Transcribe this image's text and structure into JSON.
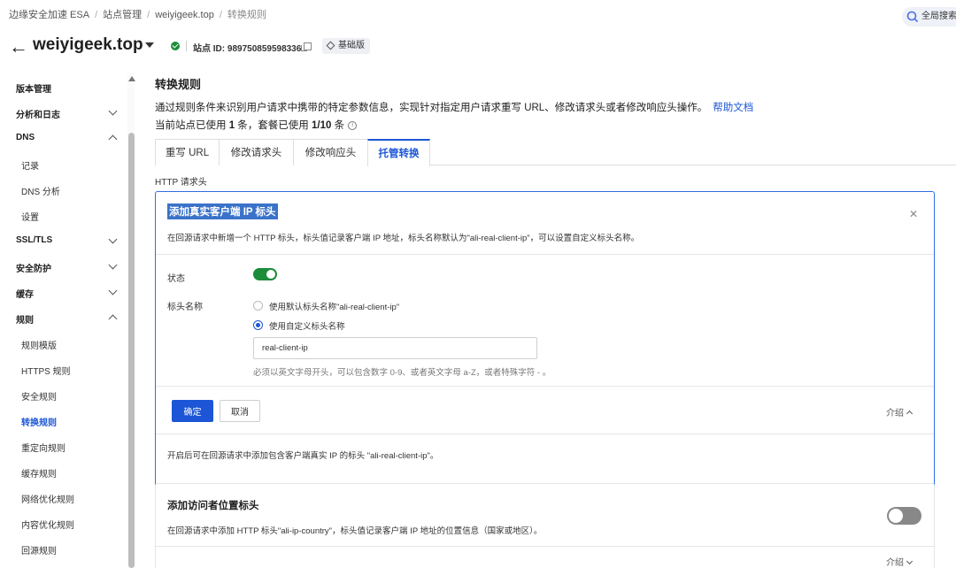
{
  "breadcrumb": {
    "items": [
      "边缘安全加速 ESA",
      "站点管理",
      "weiyigeek.top",
      "转换规则"
    ]
  },
  "global_search": {
    "label": "全局搜索"
  },
  "site": {
    "name": "weiyigeek.top",
    "id_text": "站点 ID: 989750859598336",
    "plan": "基础版"
  },
  "sidebar": {
    "items": [
      {
        "label": "版本管理",
        "kind": "group"
      },
      {
        "label": "分析和日志",
        "kind": "group"
      },
      {
        "label": "DNS",
        "kind": "group"
      },
      {
        "label": "记录",
        "kind": "sub"
      },
      {
        "label": "DNS 分析",
        "kind": "sub"
      },
      {
        "label": "设置",
        "kind": "sub"
      },
      {
        "label": "SSL/TLS",
        "kind": "group"
      },
      {
        "label": "安全防护",
        "kind": "group"
      },
      {
        "label": "缓存",
        "kind": "group"
      },
      {
        "label": "规则",
        "kind": "group"
      },
      {
        "label": "规则模版",
        "kind": "sub"
      },
      {
        "label": "HTTPS 规则",
        "kind": "sub"
      },
      {
        "label": "安全规则",
        "kind": "sub"
      },
      {
        "label": "转换规则",
        "kind": "sub-active"
      },
      {
        "label": "重定向规则",
        "kind": "sub"
      },
      {
        "label": "缓存规则",
        "kind": "sub"
      },
      {
        "label": "网络优化规则",
        "kind": "sub"
      },
      {
        "label": "内容优化规则",
        "kind": "sub"
      },
      {
        "label": "回源规则",
        "kind": "sub"
      }
    ]
  },
  "main": {
    "title": "转换规则",
    "description": "通过规则条件来识别用户请求中携带的特定参数信息，实现针对指定用户请求重写 URL、修改请求头或者修改响应头操作。",
    "help_link": "帮助文档",
    "usage_prefix": "当前站点已使用 ",
    "usage_count": "1",
    "usage_mid": " 条，套餐已使用 ",
    "usage_quota": "1/10",
    "usage_suffix": " 条",
    "tabs": [
      "重写 URL",
      "修改请求头",
      "修改响应头",
      "托管转换"
    ],
    "active_tab": "托管转换",
    "section_label": "HTTP 请求头"
  },
  "card_real_ip": {
    "title": "添加真实客户端 IP 标头",
    "description": "在回源请求中新增一个 HTTP 标头，标头值记录客户端 IP 地址，标头名称默认为\"ali-real-client-ip\"，可以设置自定义标头名称。",
    "status_label": "状态",
    "status_on": true,
    "header_name_label": "标头名称",
    "option_default": "使用默认标头名称\"ali-real-client-ip\"",
    "option_custom": "使用自定义标头名称",
    "selected_option": "custom",
    "input_value": "real-client-ip",
    "hint": "必须以英文字母开头，可以包含数字 0-9、或者英文字母 a-Z，或者特殊字符 - 。",
    "ok_label": "确定",
    "cancel_label": "取消",
    "intro_label": "介绍",
    "footer": "开启后可在回源请求中添加包含客户端真实 IP 的标头 \"ali-real-client-ip\"。"
  },
  "card_geo": {
    "title": "添加访问者位置标头",
    "description": "在回源请求中添加 HTTP 标头\"ali-ip-country\"，标头值记录客户端 IP 地址的位置信息（国家或地区）。",
    "status_on": false,
    "intro_label": "介绍"
  },
  "colors": {
    "accent": "#1c56d6",
    "success": "#1c8c3a",
    "toggle_off": "#888888"
  }
}
